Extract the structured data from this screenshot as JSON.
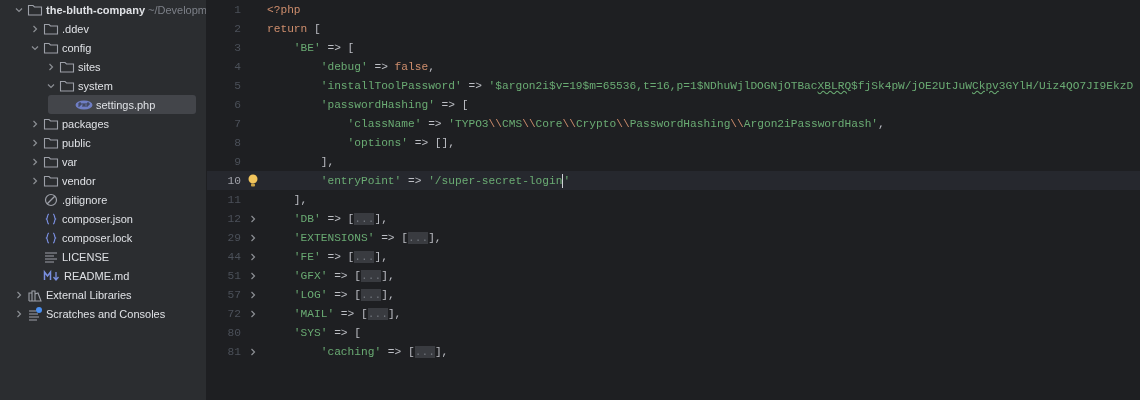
{
  "project_tree": {
    "root": {
      "label": "the-bluth-company",
      "path": "~/Developm",
      "expanded": true,
      "children": [
        {
          "label": ".ddev",
          "kind": "folder",
          "expanded": false
        },
        {
          "label": "config",
          "kind": "folder",
          "expanded": true,
          "children": [
            {
              "label": "sites",
              "kind": "folder",
              "expanded": false
            },
            {
              "label": "system",
              "kind": "folder",
              "expanded": true,
              "children": [
                {
                  "label": "settings.php",
                  "kind": "php",
                  "selected": true
                }
              ]
            }
          ]
        },
        {
          "label": "packages",
          "kind": "folder",
          "expanded": false
        },
        {
          "label": "public",
          "kind": "folder",
          "expanded": false
        },
        {
          "label": "var",
          "kind": "folder",
          "expanded": false
        },
        {
          "label": "vendor",
          "kind": "folder",
          "expanded": false
        },
        {
          "label": ".gitignore",
          "kind": "ignore",
          "selected": false
        },
        {
          "label": "composer.json",
          "kind": "json",
          "selected": false
        },
        {
          "label": "composer.lock",
          "kind": "json",
          "selected": false
        },
        {
          "label": "LICENSE",
          "kind": "text",
          "selected": false
        },
        {
          "label": "README.md",
          "kind": "markdown",
          "selected": false
        }
      ]
    },
    "extra": [
      {
        "label": "External Libraries",
        "kind": "library",
        "expanded": false
      },
      {
        "label": "Scratches and Consoles",
        "kind": "scratches",
        "expanded": false
      }
    ]
  },
  "editor": {
    "lines": [
      {
        "number": "1",
        "current": false,
        "foldable": false,
        "tokens": [
          {
            "kind": "kw",
            "text": "<?php"
          }
        ]
      },
      {
        "number": "2",
        "current": false,
        "foldable": false,
        "tokens": [
          {
            "kind": "kw",
            "text": "return"
          },
          {
            "kind": "plain",
            "text": " ["
          }
        ]
      },
      {
        "number": "3",
        "current": false,
        "foldable": false,
        "tokens": [
          {
            "kind": "str",
            "text": "    'BE'"
          },
          {
            "kind": "plain",
            "text": " => ["
          }
        ]
      },
      {
        "number": "4",
        "current": false,
        "foldable": false,
        "tokens": [
          {
            "kind": "str",
            "text": "        'debug'"
          },
          {
            "kind": "plain",
            "text": " => "
          },
          {
            "kind": "kw",
            "text": "false"
          },
          {
            "kind": "plain",
            "text": ","
          }
        ]
      },
      {
        "number": "5",
        "current": false,
        "foldable": false,
        "tokens": [
          {
            "kind": "str",
            "text": "        'installToolPassword'"
          },
          {
            "kind": "plain",
            "text": " => "
          },
          {
            "kind": "str",
            "text": "'$argon2i$v=19$m=65536,t=16,p=1$NDhuWjlDOGNjOTBac"
          },
          {
            "kind": "typo",
            "text": "XBLRQ"
          },
          {
            "kind": "str",
            "text": "$fjSk4pW/jOE2UtJuW"
          },
          {
            "kind": "typo",
            "text": "Ckpv"
          },
          {
            "kind": "str",
            "text": "3GYlH/Uiz4QO7JI9EkzD"
          }
        ]
      },
      {
        "number": "6",
        "current": false,
        "foldable": false,
        "tokens": [
          {
            "kind": "str",
            "text": "        'passwordHashing'"
          },
          {
            "kind": "plain",
            "text": " => ["
          }
        ]
      },
      {
        "number": "7",
        "current": false,
        "foldable": false,
        "tokens": [
          {
            "kind": "str",
            "text": "            'className'"
          },
          {
            "kind": "plain",
            "text": " => "
          },
          {
            "kind": "str",
            "text": "'TYPO3"
          },
          {
            "kind": "esc",
            "text": "\\\\"
          },
          {
            "kind": "str",
            "text": "CMS"
          },
          {
            "kind": "esc",
            "text": "\\\\"
          },
          {
            "kind": "str",
            "text": "Core"
          },
          {
            "kind": "esc",
            "text": "\\\\"
          },
          {
            "kind": "str",
            "text": "Crypto"
          },
          {
            "kind": "esc",
            "text": "\\\\"
          },
          {
            "kind": "str",
            "text": "PasswordHashing"
          },
          {
            "kind": "esc",
            "text": "\\\\"
          },
          {
            "kind": "str",
            "text": "Argon2iPasswordHash'"
          },
          {
            "kind": "plain",
            "text": ","
          }
        ]
      },
      {
        "number": "8",
        "current": false,
        "foldable": false,
        "tokens": [
          {
            "kind": "str",
            "text": "            'options'"
          },
          {
            "kind": "plain",
            "text": " => [],"
          }
        ]
      },
      {
        "number": "9",
        "current": false,
        "foldable": false,
        "tokens": [
          {
            "kind": "plain",
            "text": "        ],"
          }
        ]
      },
      {
        "number": "10",
        "current": true,
        "foldable": false,
        "tokens": [
          {
            "kind": "str",
            "text": "        'entryPoint'"
          },
          {
            "kind": "plain",
            "text": " => "
          },
          {
            "kind": "str",
            "text": "'/super-secret-login"
          },
          {
            "kind": "caret"
          },
          {
            "kind": "str",
            "text": "'"
          }
        ]
      },
      {
        "number": "11",
        "current": false,
        "foldable": false,
        "tokens": [
          {
            "kind": "plain",
            "text": "    ],"
          }
        ]
      },
      {
        "number": "12",
        "current": false,
        "foldable": true,
        "tokens": [
          {
            "kind": "str",
            "text": "    'DB'"
          },
          {
            "kind": "plain",
            "text": " => ["
          },
          {
            "kind": "fold",
            "text": "..."
          },
          {
            "kind": "plain",
            "text": "],"
          }
        ]
      },
      {
        "number": "29",
        "current": false,
        "foldable": true,
        "tokens": [
          {
            "kind": "str",
            "text": "    'EXTENSIONS'"
          },
          {
            "kind": "plain",
            "text": " => ["
          },
          {
            "kind": "fold",
            "text": "..."
          },
          {
            "kind": "plain",
            "text": "],"
          }
        ]
      },
      {
        "number": "44",
        "current": false,
        "foldable": true,
        "tokens": [
          {
            "kind": "str",
            "text": "    'FE'"
          },
          {
            "kind": "plain",
            "text": " => ["
          },
          {
            "kind": "fold",
            "text": "..."
          },
          {
            "kind": "plain",
            "text": "],"
          }
        ]
      },
      {
        "number": "51",
        "current": false,
        "foldable": true,
        "tokens": [
          {
            "kind": "str",
            "text": "    'GFX'"
          },
          {
            "kind": "plain",
            "text": " => ["
          },
          {
            "kind": "fold",
            "text": "..."
          },
          {
            "kind": "plain",
            "text": "],"
          }
        ]
      },
      {
        "number": "57",
        "current": false,
        "foldable": true,
        "tokens": [
          {
            "kind": "str",
            "text": "    'LOG'"
          },
          {
            "kind": "plain",
            "text": " => ["
          },
          {
            "kind": "fold",
            "text": "..."
          },
          {
            "kind": "plain",
            "text": "],"
          }
        ]
      },
      {
        "number": "72",
        "current": false,
        "foldable": true,
        "tokens": [
          {
            "kind": "str",
            "text": "    'MAIL'"
          },
          {
            "kind": "plain",
            "text": " => ["
          },
          {
            "kind": "fold",
            "text": "..."
          },
          {
            "kind": "plain",
            "text": "],"
          }
        ]
      },
      {
        "number": "80",
        "current": false,
        "foldable": false,
        "tokens": [
          {
            "kind": "str",
            "text": "    'SYS'"
          },
          {
            "kind": "plain",
            "text": " => ["
          }
        ]
      },
      {
        "number": "81",
        "current": false,
        "foldable": true,
        "tokens": [
          {
            "kind": "str",
            "text": "        'caching'"
          },
          {
            "kind": "plain",
            "text": " => ["
          },
          {
            "kind": "fold",
            "text": "..."
          },
          {
            "kind": "plain",
            "text": "],"
          }
        ]
      }
    ]
  }
}
